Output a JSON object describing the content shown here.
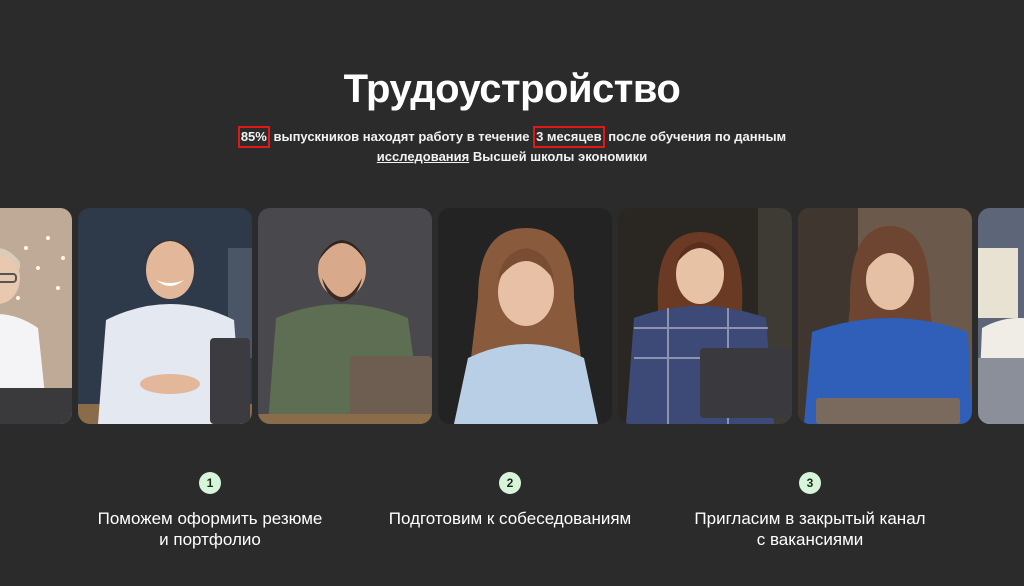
{
  "hero": {
    "title": "Трудоустройство",
    "stat_percent": "85%",
    "text_1": "выпускников находят работу в течение",
    "stat_period": "3 месяцев",
    "text_2": "после обучения по данным",
    "link_text": "исследования",
    "text_3": "Высшей школы экономики"
  },
  "photos": [
    {
      "name": "graduate-photo-1",
      "alt": "woman-with-glasses-at-laptop"
    },
    {
      "name": "graduate-photo-2",
      "alt": "smiling-man-at-laptop"
    },
    {
      "name": "graduate-photo-3",
      "alt": "bearded-man-at-laptop"
    },
    {
      "name": "graduate-photo-4",
      "alt": "woman-portrait"
    },
    {
      "name": "graduate-photo-5",
      "alt": "woman-in-plaid-shirt-at-laptop"
    },
    {
      "name": "graduate-photo-6",
      "alt": "woman-in-blue-sweater-at-laptop"
    },
    {
      "name": "graduate-photo-7",
      "alt": "person-at-laptop"
    }
  ],
  "steps": [
    {
      "number": "1",
      "line1": "Поможем оформить резюме",
      "line2": "и портфолио"
    },
    {
      "number": "2",
      "line1": "Подготовим к собеседованиям",
      "line2": ""
    },
    {
      "number": "3",
      "line1": "Пригласим в закрытый канал",
      "line2": "с вакансиями"
    }
  ],
  "colors": {
    "background": "#2b2b2c",
    "step_badge": "#d7f5d8",
    "highlight_frame": "#e01818"
  }
}
